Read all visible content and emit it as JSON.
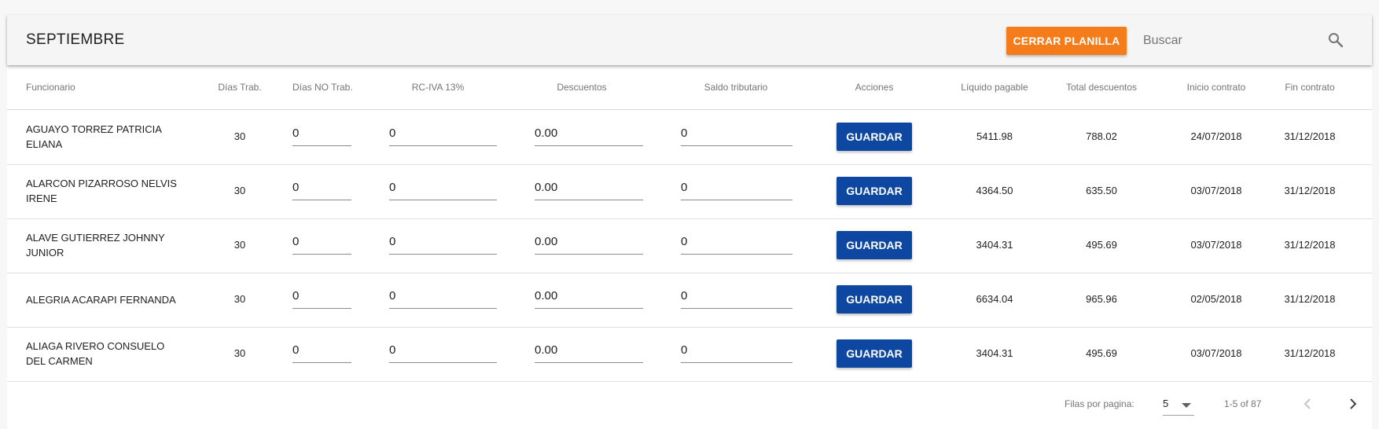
{
  "toolbar": {
    "title": "SEPTIEMBRE",
    "close_button": "CERRAR PLANILLA",
    "search_placeholder": "Buscar",
    "search_icon": "search-icon"
  },
  "colors": {
    "accent_orange": "#f47c1a",
    "save_blue": "#0d47a1"
  },
  "table": {
    "columns": [
      "Funcionario",
      "Días Trab.",
      "Días NO Trab.",
      "RC-IVA 13%",
      "Descuentos",
      "Saldo tributario",
      "Acciones",
      "Líquido pagable",
      "Total descuentos",
      "Inicio contrato",
      "Fin contrato"
    ],
    "rows": [
      {
        "name": "AGUAYO TORREZ PATRICIA ELIANA",
        "dias_trab": "30",
        "dias_no_trab": "0",
        "rc_iva": "0",
        "descuentos": "0.00",
        "saldo": "0",
        "action": "GUARDAR",
        "liquido": "5411.98",
        "total_desc": "788.02",
        "inicio": "24/07/2018",
        "fin": "31/12/2018"
      },
      {
        "name": "ALARCON PIZARROSO NELVIS IRENE",
        "dias_trab": "30",
        "dias_no_trab": "0",
        "rc_iva": "0",
        "descuentos": "0.00",
        "saldo": "0",
        "action": "GUARDAR",
        "liquido": "4364.50",
        "total_desc": "635.50",
        "inicio": "03/07/2018",
        "fin": "31/12/2018"
      },
      {
        "name": "ALAVE GUTIERREZ JOHNNY JUNIOR",
        "dias_trab": "30",
        "dias_no_trab": "0",
        "rc_iva": "0",
        "descuentos": "0.00",
        "saldo": "0",
        "action": "GUARDAR",
        "liquido": "3404.31",
        "total_desc": "495.69",
        "inicio": "03/07/2018",
        "fin": "31/12/2018"
      },
      {
        "name": "ALEGRIA ACARAPI FERNANDA",
        "dias_trab": "30",
        "dias_no_trab": "0",
        "rc_iva": "0",
        "descuentos": "0.00",
        "saldo": "0",
        "action": "GUARDAR",
        "liquido": "6634.04",
        "total_desc": "965.96",
        "inicio": "02/05/2018",
        "fin": "31/12/2018"
      },
      {
        "name": "ALIAGA RIVERO CONSUELO DEL CARMEN",
        "dias_trab": "30",
        "dias_no_trab": "0",
        "rc_iva": "0",
        "descuentos": "0.00",
        "saldo": "0",
        "action": "GUARDAR",
        "liquido": "3404.31",
        "total_desc": "495.69",
        "inicio": "03/07/2018",
        "fin": "31/12/2018"
      }
    ]
  },
  "pagination": {
    "rows_per_page_label": "Filas por pagina:",
    "rows_per_page": "5",
    "range": "1-5 of 87",
    "prev_icon": "chevron-left-icon",
    "next_icon": "chevron-right-icon"
  }
}
